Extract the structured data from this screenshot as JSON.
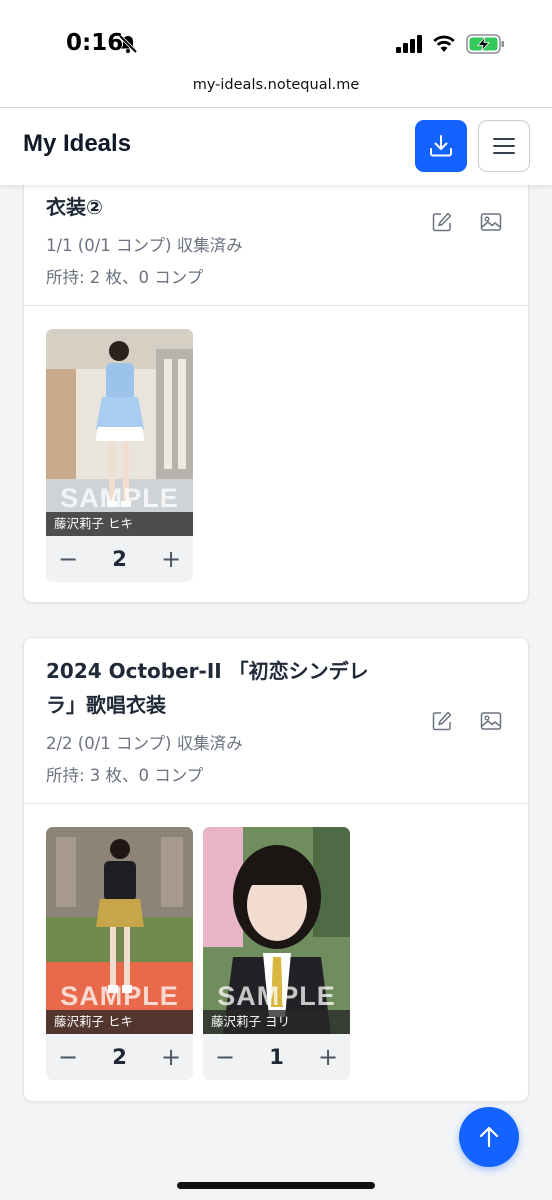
{
  "status_bar": {
    "time": "0:16",
    "url": "my-ideals.notequal.me"
  },
  "header": {
    "title": "My Ideals"
  },
  "cards": [
    {
      "title_lines": [
        "衣装②"
      ],
      "collected": "1/1 (0/1 コンプ) 収集済み",
      "owned": "所持: 2 枚、0 コンプ",
      "photos": [
        {
          "caption": "藤沢莉子 ヒキ",
          "watermark": "SAMPLE",
          "quantity": "2"
        }
      ]
    },
    {
      "title_lines": [
        "2024 October-II 「初恋シンデレ",
        "ラ」歌唱衣装"
      ],
      "collected": "2/2 (0/1 コンプ) 収集済み",
      "owned": "所持: 3 枚、0 コンプ",
      "photos": [
        {
          "caption": "藤沢莉子 ヒキ",
          "watermark": "SAMPLE",
          "quantity": "2"
        },
        {
          "caption": "藤沢莉子 ヨリ",
          "watermark": "SAMPLE",
          "quantity": "1"
        }
      ]
    }
  ],
  "stepper": {
    "minus": "−",
    "plus": "+"
  },
  "icons": {
    "download": "download-icon",
    "menu": "hamburger-menu-icon",
    "edit": "pencil-icon",
    "image": "image-icon",
    "scroll_top": "arrow-up-icon"
  },
  "colors": {
    "accent": "#1463ff",
    "battery": "#34c759"
  }
}
